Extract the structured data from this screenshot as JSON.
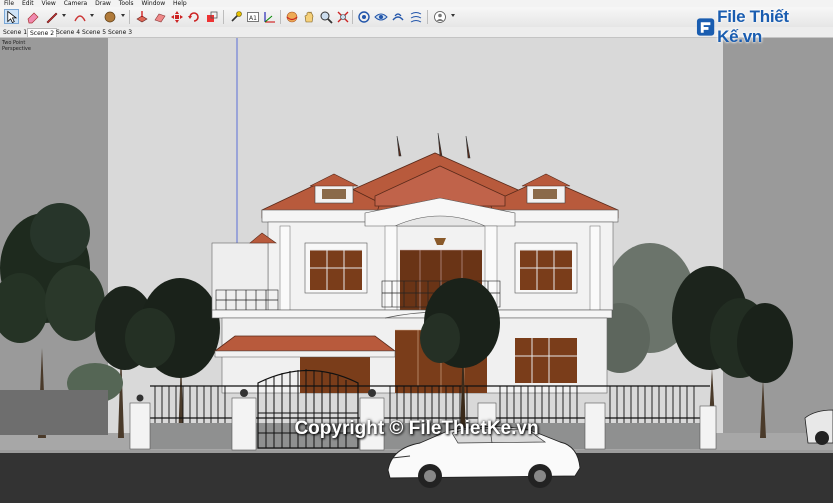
{
  "menu": [
    "File",
    "Edit",
    "View",
    "Camera",
    "Draw",
    "Tools",
    "Window",
    "Help"
  ],
  "toolbar": {
    "tools": [
      "select-tool",
      "eraser-tool",
      "line-tool",
      "arc-tool",
      "paint-bucket-tool",
      "push-pull-tool",
      "move-tool",
      "rotate-tool",
      "scale-tool",
      "offset-tool",
      "tape-measure-tool",
      "text-tool",
      "axes-tool",
      "section-plane-tool",
      "orbit-tool",
      "pan-tool",
      "zoom-tool",
      "zoom-extents-tool",
      "walk-tool",
      "look-around-tool",
      "position-camera-tool",
      "user-account-tool"
    ]
  },
  "scenes": {
    "tabs": [
      "Scene 1",
      "Scene 2",
      "Scene 4",
      "Scene 5",
      "Scene 3"
    ],
    "active_index": 1
  },
  "viewport": {
    "camera_label_line1": "Two Point",
    "camera_label_line2": "Perspective"
  },
  "watermark": {
    "text": "File Thiết Kế.vn",
    "icon": "filethietke-logo"
  },
  "copyright": {
    "text": "Copyright © FileThietKe.vn"
  },
  "colors": {
    "sky": "#d8d8d8",
    "roof": "#b85a3c",
    "wall": "#f2f2f2",
    "wood": "#7a3d1a",
    "accent": "#1a5db0"
  }
}
